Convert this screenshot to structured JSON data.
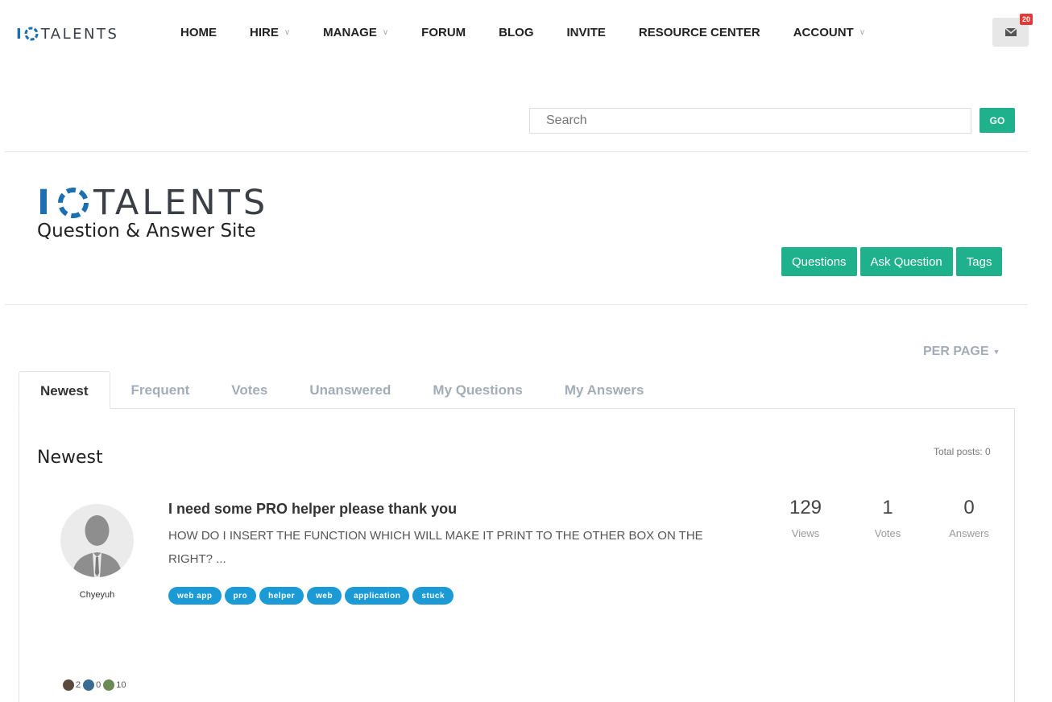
{
  "nav": {
    "brand": "TALENTS",
    "items": [
      {
        "label": "HOME",
        "dropdown": false
      },
      {
        "label": "HIRE",
        "dropdown": true
      },
      {
        "label": "MANAGE",
        "dropdown": true
      },
      {
        "label": "FORUM",
        "dropdown": false
      },
      {
        "label": "BLOG",
        "dropdown": false
      },
      {
        "label": "INVITE",
        "dropdown": false
      },
      {
        "label": "RESOURCE CENTER",
        "dropdown": false
      },
      {
        "label": "ACCOUNT",
        "dropdown": true
      }
    ],
    "mail_icon": "envelope-icon",
    "mail_count": "20"
  },
  "search": {
    "placeholder": "Search",
    "button": "GO"
  },
  "qa_logo": {
    "title": "TALENTS",
    "subtitle": "Question & Answer Site"
  },
  "actions": [
    "Questions",
    "Ask Question",
    "Tags"
  ],
  "per_page": "PER PAGE",
  "tabs": [
    "Newest",
    "Frequent",
    "Votes",
    "Unanswered",
    "My Questions",
    "My Answers"
  ],
  "section": {
    "title": "Newest",
    "total": "Total posts: 0"
  },
  "post": {
    "author": "Chyeyuh",
    "title": "I need some PRO helper please thank you",
    "body": "HOW DO I INSERT THE FUNCTION WHICH WILL MAKE IT PRINT TO THE OTHER BOX ON THE RIGHT? ...",
    "tags": [
      "web app",
      "pro",
      "helper",
      "web",
      "application",
      "stuck"
    ],
    "stats": [
      {
        "value": "129",
        "label": "Views"
      },
      {
        "value": "1",
        "label": "Votes"
      },
      {
        "value": "0",
        "label": "Answers"
      }
    ],
    "reputation": [
      {
        "count": "2",
        "color": "#5b4a3c"
      },
      {
        "count": "0",
        "color": "#3a6c93"
      },
      {
        "count": "10",
        "color": "#6b8a55"
      }
    ]
  },
  "colors": {
    "accent": "#1fb08c",
    "tag": "#1b9ad6",
    "brand_blue": "#1c6fb0"
  }
}
